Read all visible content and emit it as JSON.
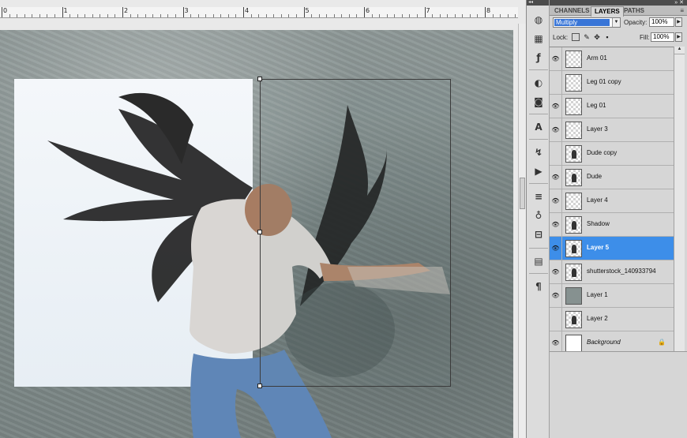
{
  "ruler": {
    "labels": [
      "0",
      "1",
      "2",
      "3",
      "4",
      "5",
      "6",
      "7",
      "8"
    ]
  },
  "panel": {
    "tabs": [
      {
        "label": "CHANNELS",
        "active": false
      },
      {
        "label": "LAYERS",
        "active": true
      },
      {
        "label": "PATHS",
        "active": false
      }
    ],
    "blend_mode": "Multiply",
    "opacity_label": "Opacity:",
    "opacity_value": "100%",
    "lock_label": "Lock:",
    "fill_label": "Fill:",
    "fill_value": "100%"
  },
  "layers": [
    {
      "name": "Arm 01",
      "visible": true,
      "thumb": "transparent"
    },
    {
      "name": "Leg 01 copy",
      "visible": false,
      "thumb": "transparent"
    },
    {
      "name": "Leg 01",
      "visible": true,
      "thumb": "transparent"
    },
    {
      "name": "Layer 3",
      "visible": true,
      "thumb": "transparent"
    },
    {
      "name": "Dude copy",
      "visible": false,
      "thumb": "figure"
    },
    {
      "name": "Dude",
      "visible": true,
      "thumb": "figure"
    },
    {
      "name": "Layer 4",
      "visible": true,
      "thumb": "transparent"
    },
    {
      "name": "Shadow",
      "visible": true,
      "thumb": "figure"
    },
    {
      "name": "Layer 5",
      "visible": true,
      "thumb": "figure",
      "selected": true
    },
    {
      "name": "shutterstock_140933794",
      "visible": true,
      "thumb": "figure"
    },
    {
      "name": "Layer 1",
      "visible": true,
      "thumb": "concrete"
    },
    {
      "name": "Layer 2",
      "visible": false,
      "thumb": "figure"
    },
    {
      "name": "Background",
      "visible": true,
      "thumb": "white",
      "italic": true,
      "locked": true
    }
  ],
  "icons": {
    "eye": "eye-icon",
    "lock": "lock-icon"
  },
  "colors": {
    "selection": "#3d8ee9",
    "panel_bg": "#d6d6d6",
    "canvas": "#8a9594"
  }
}
